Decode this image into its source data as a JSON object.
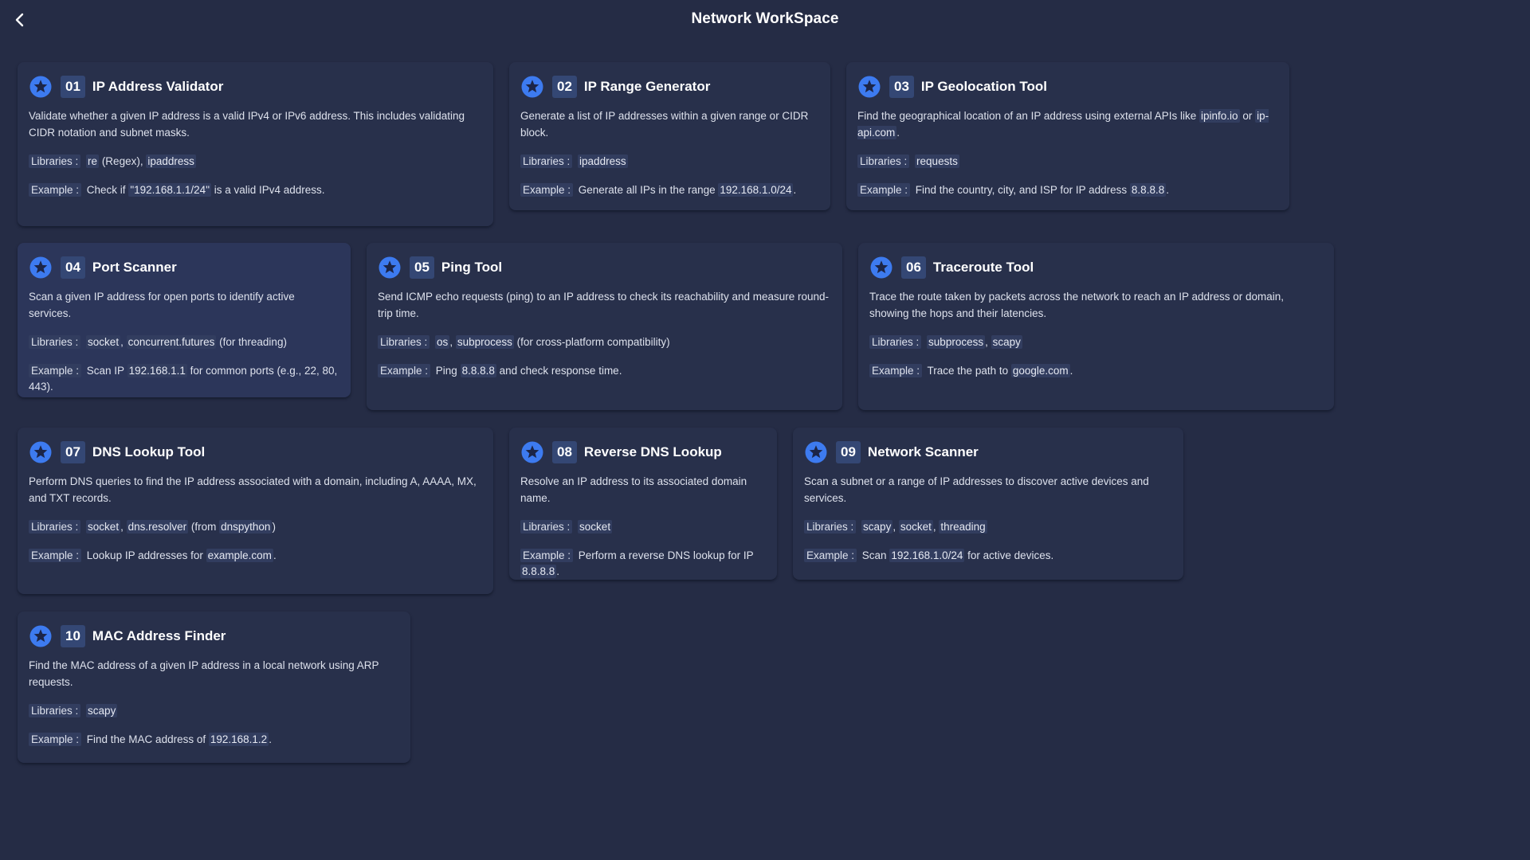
{
  "header": {
    "title": "Network WorkSpace"
  },
  "cards": [
    {
      "number": "01",
      "title": "IP Address Validator",
      "description": [
        "Validate whether a given IP address is a valid IPv4 or IPv6 address. This includes validating CIDR notation and subnet masks."
      ],
      "libraries": [
        "Libraries :",
        " ",
        {
          "code": "re"
        },
        " (Regex), ",
        {
          "code": "ipaddress"
        }
      ],
      "example": [
        "Example :",
        " Check if ",
        {
          "code": "\"192.168.1.1/24\""
        },
        " is a valid IPv4 address."
      ]
    },
    {
      "number": "02",
      "title": "IP Range Generator",
      "description": [
        "Generate a list of IP addresses within a given range or CIDR block."
      ],
      "libraries": [
        "Libraries :",
        " ",
        {
          "code": "ipaddress"
        }
      ],
      "example": [
        "Example :",
        " Generate all IPs in the range ",
        {
          "code": "192.168.1.0/24"
        },
        "."
      ]
    },
    {
      "number": "03",
      "title": "IP Geolocation Tool",
      "description": [
        "Find the geographical location of an IP address using external APIs like ",
        {
          "code": "ipinfo.io"
        },
        " or ",
        {
          "code": "ip-api.com"
        },
        "."
      ],
      "libraries": [
        "Libraries :",
        " ",
        {
          "code": "requests"
        }
      ],
      "example": [
        "Example :",
        " Find the country, city, and ISP for IP address ",
        {
          "code": "8.8.8.8"
        },
        "."
      ]
    },
    {
      "number": "04",
      "title": "Port Scanner",
      "active": true,
      "description": [
        "Scan a given IP address for open ports to identify active services."
      ],
      "libraries": [
        "Libraries :",
        " ",
        {
          "code": "socket"
        },
        ", ",
        {
          "code": "concurrent.futures"
        },
        " (for threading)"
      ],
      "example": [
        "Example :",
        " Scan IP ",
        {
          "code": "192.168.1.1"
        },
        " for common ports (e.g., 22, 80, 443)."
      ]
    },
    {
      "number": "05",
      "title": "Ping Tool",
      "description": [
        "Send ICMP echo requests (ping) to an IP address to check its reachability and measure round-trip time."
      ],
      "libraries": [
        "Libraries :",
        " ",
        {
          "code": "os"
        },
        ", ",
        {
          "code": "subprocess"
        },
        " (for cross-platform compatibility)"
      ],
      "example": [
        "Example :",
        " Ping ",
        {
          "code": "8.8.8.8"
        },
        " and check response time."
      ]
    },
    {
      "number": "06",
      "title": "Traceroute Tool",
      "description": [
        "Trace the route taken by packets across the network to reach an IP address or domain, showing the hops and their latencies."
      ],
      "libraries": [
        "Libraries :",
        " ",
        {
          "code": "subprocess"
        },
        ", ",
        {
          "code": "scapy"
        }
      ],
      "example": [
        "Example :",
        " Trace the path to ",
        {
          "code": "google.com"
        },
        "."
      ]
    },
    {
      "number": "07",
      "title": "DNS Lookup Tool",
      "description": [
        "Perform DNS queries to find the IP address associated with a domain, including A, AAAA, MX, and TXT records."
      ],
      "libraries": [
        "Libraries :",
        " ",
        {
          "code": "socket"
        },
        ", ",
        {
          "code": "dns.resolver"
        },
        " (from ",
        {
          "code": "dnspython"
        },
        ")"
      ],
      "example": [
        "Example :",
        " Lookup IP addresses for ",
        {
          "code": "example.com"
        },
        "."
      ]
    },
    {
      "number": "08",
      "title": "Reverse DNS Lookup",
      "description": [
        "Resolve an IP address to its associated domain name."
      ],
      "libraries": [
        "Libraries :",
        " ",
        {
          "code": "socket"
        }
      ],
      "example": [
        "Example :",
        " Perform a reverse DNS lookup for IP ",
        {
          "code": "8.8.8.8"
        },
        "."
      ]
    },
    {
      "number": "09",
      "title": "Network Scanner",
      "description": [
        "Scan a subnet or a range of IP addresses to discover active devices and services."
      ],
      "libraries": [
        "Libraries :",
        " ",
        {
          "code": "scapy"
        },
        ", ",
        {
          "code": "socket"
        },
        ", ",
        {
          "code": "threading"
        }
      ],
      "example": [
        "Example :",
        " Scan ",
        {
          "code": "192.168.1.0/24"
        },
        " for active devices."
      ]
    },
    {
      "number": "10",
      "title": "MAC Address Finder",
      "description": [
        "Find the MAC address of a given IP address in a local network using ARP requests."
      ],
      "libraries": [
        "Libraries :",
        " ",
        {
          "code": "scapy"
        }
      ],
      "example": [
        "Example :",
        " Find the MAC address of ",
        {
          "code": "192.168.1.2"
        },
        "."
      ]
    }
  ],
  "colors": {
    "background": "#252c45",
    "card": "#28304b",
    "accent": "#3d7bf0"
  },
  "icons": {
    "back": "chevron-left-icon",
    "card": "star-icon"
  }
}
